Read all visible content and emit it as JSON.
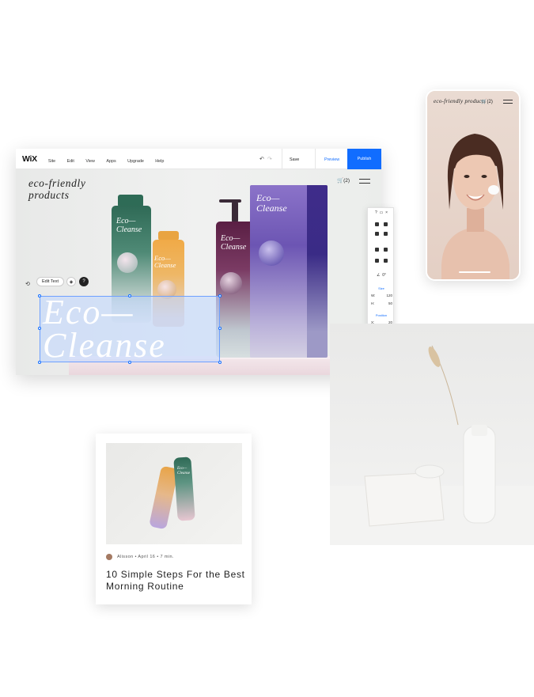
{
  "editor": {
    "logo": "WiX",
    "menu": [
      "Site",
      "Edit",
      "View",
      "Apps",
      "Upgrade",
      "Help"
    ],
    "undo_icon": "undo-icon",
    "redo_icon": "redo-icon",
    "save_label": "Save",
    "preview_label": "Preview",
    "publish_label": "Publish",
    "accent_color": "#116dff"
  },
  "site": {
    "title": "eco-friendly products",
    "cart_count": "(2)",
    "hero_text_line1": "Eco—",
    "hero_text_line2": "Cleanse",
    "bottle_label_line1": "Eco—",
    "bottle_label_line2": "Cleanse",
    "edit_text_label": "Edit Text",
    "help_label": "?"
  },
  "inspector": {
    "angle": "0°",
    "size_label": "Size",
    "w_label": "W:",
    "w_value": "120",
    "h_label": "H:",
    "h_value": "50",
    "position_label": "Position",
    "x_label": "X:",
    "x_value": "20",
    "y_label": "Y:",
    "y_value": "164"
  },
  "mobile": {
    "title": "eco-friendly products",
    "cart_count": "(2)"
  },
  "blog_card": {
    "author": "Alisson",
    "date": "April 16",
    "read_time": "7 min.",
    "title": "10 Simple Steps For the Best Morning Routine",
    "label_line1": "Eco—",
    "label_line2": "Cleanse"
  }
}
